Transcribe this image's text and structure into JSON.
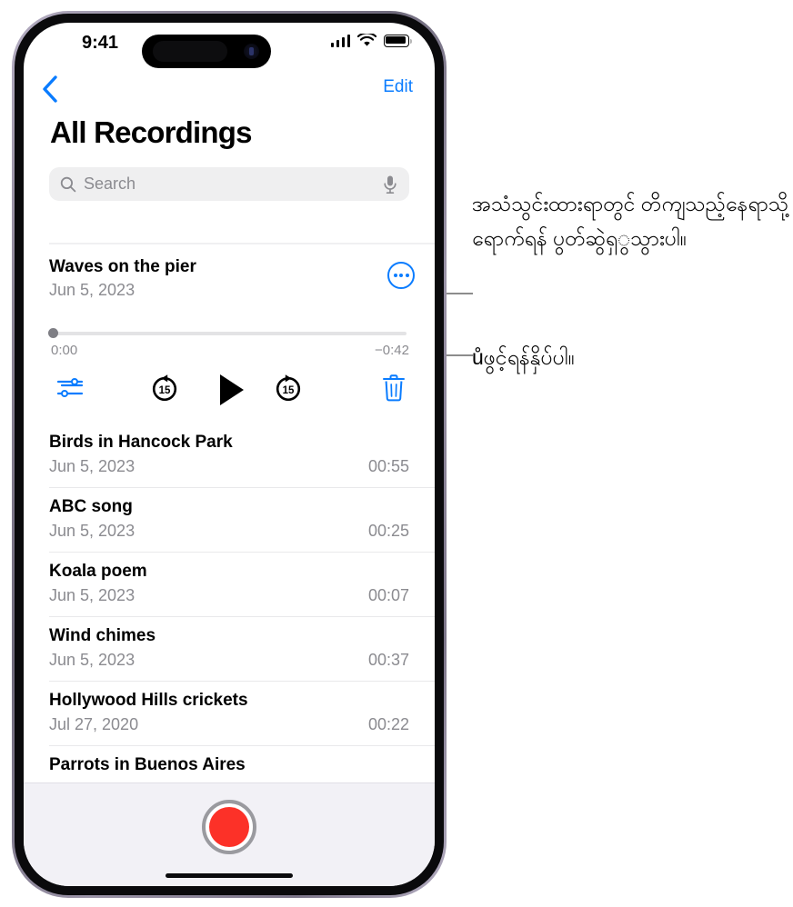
{
  "status_bar": {
    "time": "9:41",
    "signal_icon": "cellular-bars-icon",
    "wifi_icon": "wifi-icon",
    "battery_icon": "battery-icon"
  },
  "nav": {
    "back_icon": "chevron-left-icon",
    "edit_label": "Edit"
  },
  "header": {
    "title": "All Recordings"
  },
  "search": {
    "placeholder": "Search",
    "value": "",
    "search_icon": "search-icon",
    "mic_icon": "microphone-icon"
  },
  "player": {
    "title": "Waves on the pier",
    "date": "Jun 5, 2023",
    "more_icon": "ellipsis-circle-icon",
    "elapsed": "0:00",
    "remaining": "−0:42",
    "progress_percent": 0,
    "controls": {
      "enhance": "audio-enhance-icon",
      "skip_back": "skip-back-15-icon",
      "skip_back_label": "15",
      "play": "play-icon",
      "skip_forward": "skip-forward-15-icon",
      "skip_forward_label": "15",
      "delete": "trash-icon"
    }
  },
  "recordings": [
    {
      "name": "Birds in Hancock Park",
      "date": "Jun 5, 2023",
      "duration": "00:55"
    },
    {
      "name": "ABC song",
      "date": "Jun 5, 2023",
      "duration": "00:25"
    },
    {
      "name": "Koala poem",
      "date": "Jun 5, 2023",
      "duration": "00:07"
    },
    {
      "name": "Wind chimes",
      "date": "Jun 5, 2023",
      "duration": "00:37"
    },
    {
      "name": "Hollywood Hills crickets",
      "date": "Jul 27, 2020",
      "duration": "00:22"
    },
    {
      "name": "Parrots in Buenos Aires",
      "date": "",
      "duration": ""
    }
  ],
  "bottom_bar": {
    "record_button_icon": "record-button-icon"
  },
  "callouts": [
    {
      "id": "scrubber-callout",
      "text": "အသံသွင်းထားရာတွင် တိကျသည့်နေရာသို့ရောက်ရန် ပွတ်ဆွဲရှွသွားပါ။"
    },
    {
      "id": "play-callout",
      "text": "ůဖွင့်ရန်နှိပ်ပါ။"
    }
  ],
  "colors": {
    "accent_blue": "#0a7cff",
    "record_red": "#fc3128",
    "secondary_text": "#8b8b90",
    "separator": "#e9e9eb",
    "bottom_bar_bg": "#f2f1f6"
  }
}
